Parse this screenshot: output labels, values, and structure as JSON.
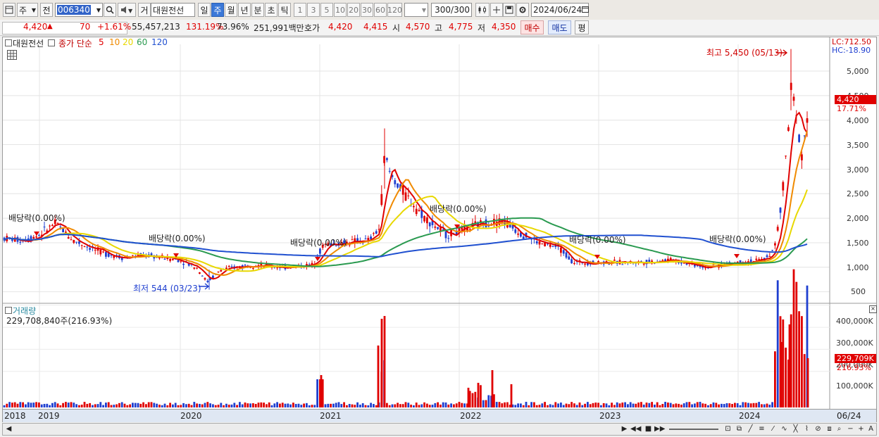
{
  "toolbar": {
    "market": "주",
    "prev": "전",
    "code": "006340",
    "type": "거",
    "name": "대원전선",
    "periods": [
      "일",
      "주",
      "월",
      "년",
      "분",
      "초",
      "틱"
    ],
    "selected_period": "주",
    "intervals": [
      "1",
      "3",
      "5",
      "10",
      "20",
      "30",
      "60",
      "120"
    ],
    "count": "300",
    "count_total": "/300",
    "date": "2024/06/24"
  },
  "quote": {
    "price": "4,420",
    "arrow": "▲",
    "change": "70",
    "pct": "+1.61%",
    "volume": "55,457,213",
    "vol_ratio": "131.19%",
    "turnover": "73.96%",
    "amount": "251,991백만",
    "hoga_label": "호가",
    "bid": "4,420",
    "ask": "4,415",
    "open_label": "시",
    "open": "4,570",
    "high_label": "고",
    "high": "4,775",
    "low_label": "저",
    "low": "4,350",
    "buy_button": "매수",
    "sell_button": "매도",
    "eval_button": "평"
  },
  "legend": {
    "name": "대원전선",
    "ma_label": "종가 단순",
    "ma_items": [
      {
        "label": "5",
        "color": "#e00000"
      },
      {
        "label": "10",
        "color": "#f08a00"
      },
      {
        "label": "20",
        "color": "#e8d800"
      },
      {
        "label": "60",
        "color": "#2a9a50"
      },
      {
        "label": "120",
        "color": "#2050d0"
      }
    ]
  },
  "price_axis": [
    "5,000",
    "4,500",
    "4,000",
    "3,500",
    "3,000",
    "2,500",
    "2,000",
    "1,500",
    "1,000",
    "500"
  ],
  "vol_axis": [
    "400,000K",
    "300,000K",
    "200,000K",
    "100,000K"
  ],
  "corner": {
    "lc": "LC:712.50",
    "hc": "HC:-18.90"
  },
  "price_tag": {
    "value": "4,420",
    "pct": "17.71%"
  },
  "vol_tag": {
    "value": "229,709K",
    "pct": "216.93%"
  },
  "volume_panel": {
    "title": "거래량",
    "value": "229,708,840주(216.93%)"
  },
  "annotations": {
    "high": "최고 5,450 (05/13)",
    "low": "최저 544 (03/23)",
    "dividend": "배당락(0.00%)"
  },
  "x_axis": [
    "2018",
    "2019",
    "2020",
    "2021",
    "2022",
    "2023",
    "2024",
    "06/24"
  ],
  "chart_data": {
    "type": "candlestick",
    "ylim": [
      300,
      5600
    ],
    "x": [
      "2018",
      "2019",
      "2020",
      "2021",
      "2022",
      "2023",
      "2024"
    ],
    "close_approx": [
      1600,
      1900,
      1200,
      1050,
      1550,
      1200,
      1700,
      1100,
      1200,
      1200,
      1050,
      4420
    ],
    "high": 5450,
    "low": 544,
    "last_volume_k": 229709
  }
}
